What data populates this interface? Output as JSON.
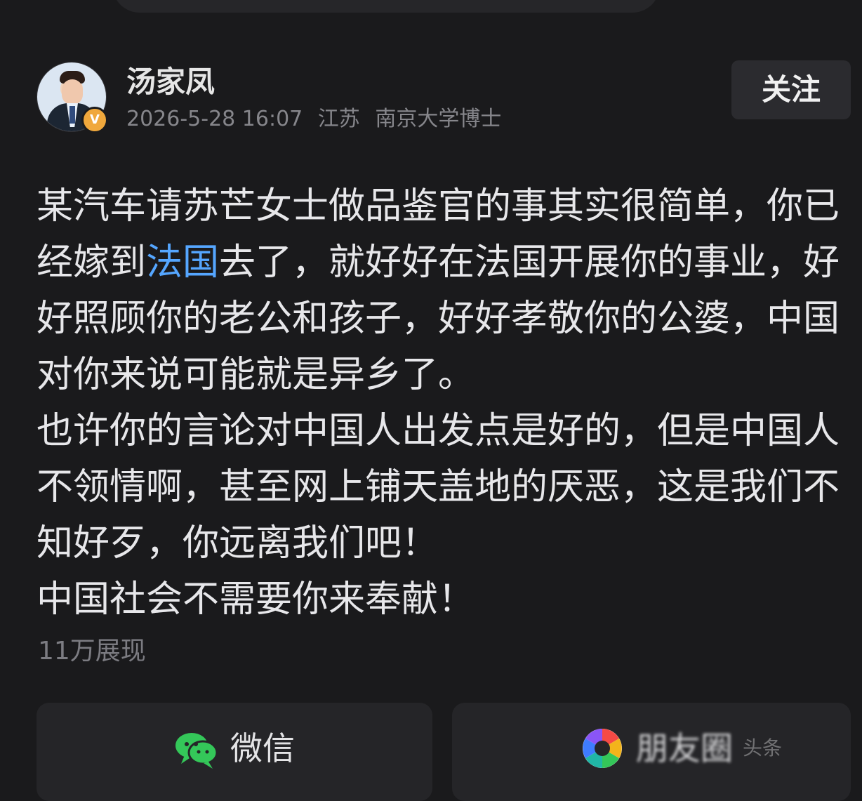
{
  "author": {
    "name": "汤家凤",
    "verified_badge": "V",
    "published_at": "2026-5-28 16:07",
    "location": "江苏",
    "credential": "南京大学博士"
  },
  "actions": {
    "follow_label": "关注"
  },
  "post": {
    "paragraph_1_before_link": "某汽车请苏芒女士做品鉴官的事其实很简单，你已经嫁到",
    "paragraph_1_link": "法国",
    "paragraph_1_after_link": "去了，就好好在法国开展你的事业，好好照顾你的老公和孩子，好好孝敬你的公婆，中国对你来说可能就是异乡了。",
    "paragraph_2": "也许你的言论对中国人出发点是好的，但是中国人不领情啊，甚至网上铺天盖地的厌恶，这是我们不知好歹，你远离我们吧！",
    "paragraph_3": "中国社会不需要你来奉献！",
    "views": "11万展现"
  },
  "share": {
    "wechat_label": "微信",
    "moments_label": "朋友圈",
    "watermark": "头条"
  },
  "colors": {
    "background": "#1a1a1c",
    "link": "#55a6ff",
    "secondary_text": "#86868b",
    "badge": "#f0a83c"
  },
  "icons": {
    "avatar": "author-photo",
    "verified": "verified-badge-icon",
    "wechat": "wechat-icon",
    "moments": "moments-icon"
  }
}
